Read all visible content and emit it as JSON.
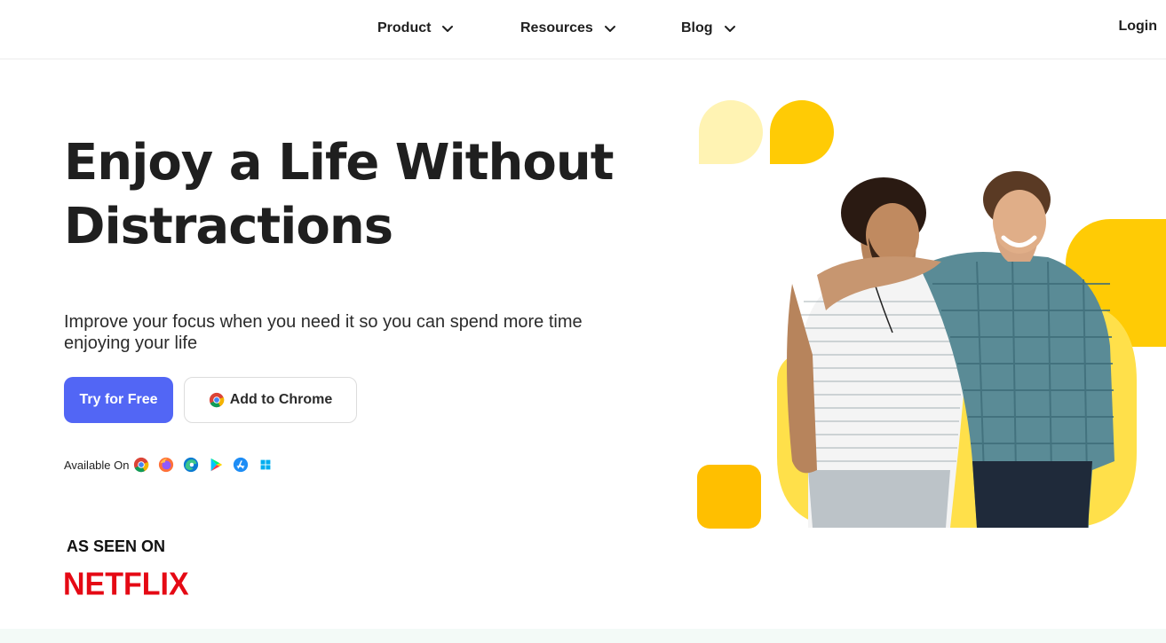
{
  "nav": {
    "items": [
      {
        "label": "Product"
      },
      {
        "label": "Resources"
      },
      {
        "label": "Blog"
      }
    ],
    "login_label": "Login"
  },
  "hero": {
    "headline_line1": "Enjoy a Life Without",
    "headline_line2": "Distractions",
    "subhead": "Improve your focus when you need it so you can spend more time enjoying your life",
    "primary_button": "Try for Free",
    "secondary_button": "Add to Chrome",
    "available_label": "Available On",
    "platforms": [
      "chrome-icon",
      "firefox-icon",
      "edge-icon",
      "google-play-icon",
      "app-store-icon",
      "windows-icon"
    ]
  },
  "seen_on": {
    "label": "AS SEEN ON",
    "brand": "NETFLIX"
  },
  "colors": {
    "primary": "#5266f5",
    "yellow": "#ffd000",
    "pale_yellow": "#fff3b3",
    "netflix_red": "#e50914"
  }
}
